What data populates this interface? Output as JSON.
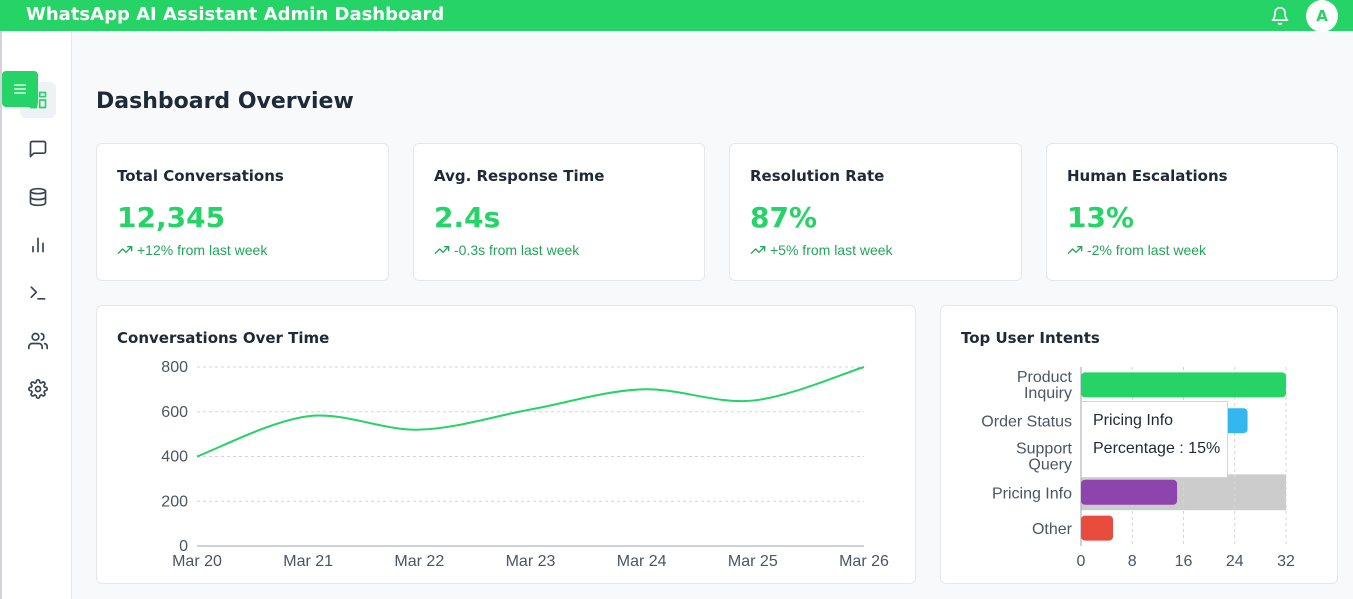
{
  "header": {
    "title": "WhatsApp AI Assistant Admin Dashboard",
    "avatar_initial": "A",
    "bg_color": "#25d366"
  },
  "sidebar": {
    "menu_icon": "menu-icon",
    "items": [
      {
        "icon": "dashboard-icon",
        "active": true
      },
      {
        "icon": "message-icon",
        "active": false
      },
      {
        "icon": "database-icon",
        "active": false
      },
      {
        "icon": "bar-chart-icon",
        "active": false
      },
      {
        "icon": "terminal-icon",
        "active": false
      },
      {
        "icon": "users-icon",
        "active": false
      },
      {
        "icon": "settings-icon",
        "active": false
      }
    ]
  },
  "main": {
    "title": "Dashboard Overview",
    "stats": [
      {
        "label": "Total Conversations",
        "value": "12,345",
        "change": "+12% from last week"
      },
      {
        "label": "Avg. Response Time",
        "value": "2.4s",
        "change": "-0.3s from last week"
      },
      {
        "label": "Resolution Rate",
        "value": "87%",
        "change": "+5% from last week"
      },
      {
        "label": "Human Escalations",
        "value": "13%",
        "change": "-2% from last week"
      }
    ],
    "line_card_title": "Conversations Over Time",
    "bar_card_title": "Top User Intents",
    "tooltip": {
      "name": "Pricing Info",
      "value_text": "Percentage : 15%"
    }
  },
  "chart_data": [
    {
      "type": "line",
      "title": "Conversations Over Time",
      "x": [
        "Mar 20",
        "Mar 21",
        "Mar 22",
        "Mar 23",
        "Mar 24",
        "Mar 25",
        "Mar 26"
      ],
      "series": [
        {
          "values": [
            400,
            580,
            520,
            610,
            700,
            650,
            800
          ],
          "color": "#25d366"
        }
      ],
      "ylim": [
        0,
        800
      ],
      "yticks": [
        0,
        200,
        400,
        600,
        800
      ],
      "grid": true
    },
    {
      "type": "bar",
      "orientation": "horizontal",
      "title": "Top User Intents",
      "categories": [
        "Product Inquiry",
        "Order Status",
        "Support Query",
        "Pricing Info",
        "Other"
      ],
      "values": [
        32,
        26,
        20,
        15,
        5
      ],
      "colors": [
        "#25d366",
        "#34b7f1",
        "#34b7f1",
        "#8e44ad",
        "#e74c3c"
      ],
      "xlim": [
        0,
        32
      ],
      "xticks": [
        0,
        8,
        16,
        24,
        32
      ],
      "highlighted": "Pricing Info",
      "grid": true
    }
  ]
}
